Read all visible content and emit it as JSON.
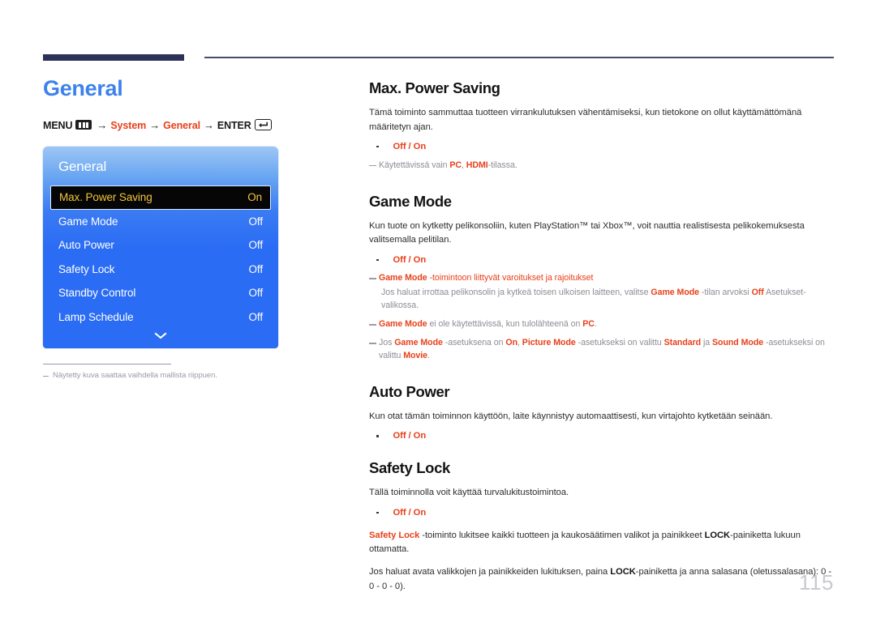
{
  "page": {
    "number": "115",
    "chapter_title": "General",
    "accent_blue": "#3d82ec",
    "accent_red": "#e8401a",
    "rule_navy": "#2e3157"
  },
  "menu_path": {
    "menu_label": "MENU",
    "menu_icon": "menu-grid-icon",
    "arrow": "→",
    "seg_system": "System",
    "seg_general": "General",
    "enter_label": "ENTER",
    "enter_icon": "enter-return-icon"
  },
  "osd": {
    "title": "General",
    "chevron_icon": "chevron-down-icon",
    "rows": [
      {
        "label": "Max. Power Saving",
        "value": "On",
        "selected": true
      },
      {
        "label": "Game Mode",
        "value": "Off",
        "selected": false
      },
      {
        "label": "Auto Power",
        "value": "Off",
        "selected": false
      },
      {
        "label": "Safety Lock",
        "value": "Off",
        "selected": false
      },
      {
        "label": "Standby Control",
        "value": "Off",
        "selected": false
      },
      {
        "label": "Lamp Schedule",
        "value": "Off",
        "selected": false
      }
    ]
  },
  "figure_footnote": "Näytetty kuva saattaa vaihdella mallista riippuen.",
  "sections": {
    "max_power_saving": {
      "heading": "Max. Power Saving",
      "body": "Tämä toiminto sammuttaa tuotteen virrankulutuksen vähentämiseksi, kun tietokone on ollut käyttämättömänä määritetyn ajan.",
      "options": "Off / On",
      "note_pre": "Käytettävissä vain ",
      "note_pc": "PC",
      "note_mid": ", ",
      "note_hdmi": "HDMI",
      "note_post": "-tilassa."
    },
    "game_mode": {
      "heading": "Game Mode",
      "body": "Kun tuote on kytketty pelikonsoliin, kuten PlayStation™ tai Xbox™, voit nauttia realistisesta pelikokemuksesta valitsemalla pelitilan.",
      "options": "Off / On",
      "note1": {
        "term": "Game Mode",
        "text": " -toimintoon liittyvät varoitukset ja rajoitukset",
        "sub_pre": "Jos haluat irrottaa pelikonsolin ja kytkeä toisen ulkoisen laitteen, valitse ",
        "sub_term": "Game Mode",
        "sub_mid": " -tilan arvoksi ",
        "sub_off": "Off",
        "sub_post": " Asetukset-valikossa."
      },
      "note2": {
        "term": "Game Mode",
        "mid": " ei ole käytettävissä, kun tulolähteenä on ",
        "pc": "PC",
        "post": "."
      },
      "note3": {
        "pre": "Jos ",
        "term1": "Game Mode",
        "mid1": " -asetuksena on ",
        "on": "On",
        "mid2": ", ",
        "term2": "Picture Mode",
        "mid3": " -asetukseksi on valittu ",
        "standard": "Standard",
        "mid4": " ja ",
        "term3": "Sound Mode",
        "mid5": " -asetukseksi on valittu ",
        "movie": "Movie",
        "post": "."
      }
    },
    "auto_power": {
      "heading": "Auto Power",
      "body": "Kun otat tämän toiminnon käyttöön, laite käynnistyy automaattisesti, kun virtajohto kytketään seinään.",
      "options": "Off / On"
    },
    "safety_lock": {
      "heading": "Safety Lock",
      "body": "Tällä toiminnolla voit käyttää turvalukitustoimintoa.",
      "options": "Off / On",
      "para1": {
        "term": "Safety Lock",
        "mid": " -toiminto lukitsee kaikki tuotteen ja kaukosäätimen valikot ja painikkeet ",
        "lock": "LOCK",
        "post": "-painiketta lukuun ottamatta."
      },
      "para2": {
        "pre": "Jos haluat avata valikkojen ja painikkeiden lukituksen, paina ",
        "lock": "LOCK",
        "post": "-painiketta ja anna salasana (oletussalasana): 0 - 0 - 0 - 0)."
      }
    }
  }
}
